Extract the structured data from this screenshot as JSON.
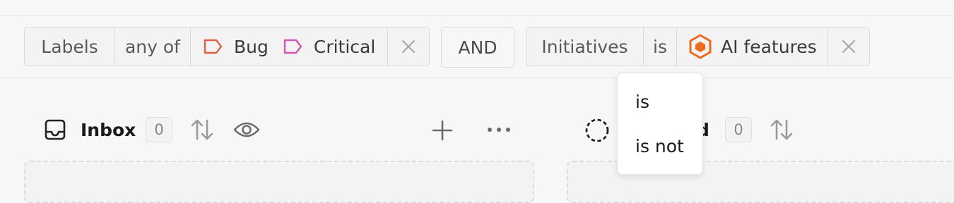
{
  "filters": {
    "filter1": {
      "field": "Labels",
      "operator": "any of",
      "values": [
        {
          "label": "Bug",
          "color": "#e0623f"
        },
        {
          "label": "Critical",
          "color": "#d254b5"
        }
      ]
    },
    "conjunction": "AND",
    "filter2": {
      "field": "Initiatives",
      "operator": "is",
      "value": "AI features",
      "value_icon_color": "#ee6a1f"
    }
  },
  "operator_menu": {
    "options": [
      "is",
      "is not"
    ]
  },
  "columns": [
    {
      "title": "Inbox",
      "count": "0",
      "icon": "inbox-icon"
    },
    {
      "title": "d",
      "count": "0",
      "icon": "backlog-dashed-circle-icon"
    }
  ]
}
